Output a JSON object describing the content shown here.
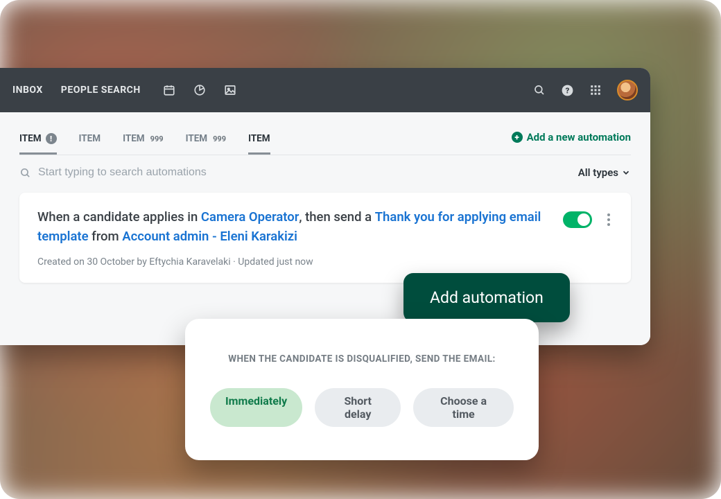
{
  "topnav": {
    "inbox": "INBOX",
    "people_search": "PEOPLE SEARCH"
  },
  "tabs": [
    {
      "label": "ITEM",
      "alert": true,
      "count": null,
      "active": true
    },
    {
      "label": "ITEM",
      "alert": false,
      "count": null,
      "active": false
    },
    {
      "label": "ITEM",
      "alert": false,
      "count": "999",
      "active": false
    },
    {
      "label": "ITEM",
      "alert": false,
      "count": "999",
      "active": false
    },
    {
      "label": "ITEM",
      "alert": false,
      "count": null,
      "active": true
    }
  ],
  "add_new_automation": "Add a new automation",
  "search": {
    "placeholder": "Start typing to search automations"
  },
  "filter": {
    "label": "All types"
  },
  "automation": {
    "prefix1": "When a candidate applies in ",
    "link1": "Camera Operator",
    "mid1": ", then send a ",
    "link2": "Thank you for applying email template",
    "mid2": " from ",
    "link3": "Account admin - Eleni Karakizi",
    "meta": "Created on 30 October by Eftychia Karavelaki · Updated just now",
    "enabled": true
  },
  "cta_button": "Add automation",
  "popup": {
    "heading": "WHEN THE CANDIDATE IS DISQUALIFIED, SEND THE EMAIL:",
    "options": [
      {
        "label": "Immediately",
        "selected": true
      },
      {
        "label": "Short delay",
        "selected": false
      },
      {
        "label": "Choose a time",
        "selected": false
      }
    ]
  },
  "colors": {
    "accent_green": "#007a5a",
    "toggle_green": "#00b368",
    "dark_green": "#004d3d",
    "link_blue": "#1973d2"
  }
}
